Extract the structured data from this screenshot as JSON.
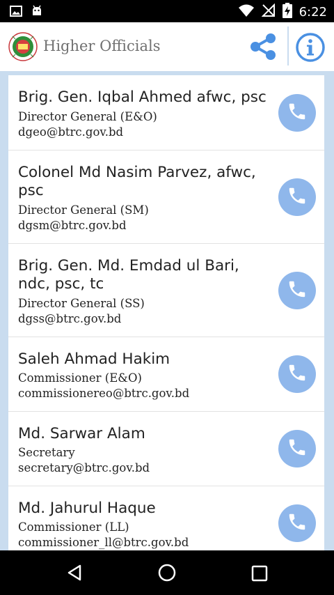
{
  "status_bar": {
    "time": "6:22",
    "left_icons": [
      "image-icon",
      "android-icon"
    ],
    "right_icons": [
      "wifi-icon",
      "no-signal-icon",
      "battery-charging-icon"
    ]
  },
  "app_bar": {
    "title": "Higher Officials",
    "logo": "btrc-logo",
    "actions": [
      "share-icon",
      "info-icon"
    ],
    "accent_color": "#4a90e2"
  },
  "officials": [
    {
      "name": "Brig. Gen. Iqbal Ahmed afwc, psc",
      "role": "Director General (E&O)",
      "email": "dgeo@btrc.gov.bd"
    },
    {
      "name": "Colonel Md Nasim Parvez, afwc, psc",
      "role": "Director General (SM)",
      "email": "dgsm@btrc.gov.bd"
    },
    {
      "name": "Brig. Gen. Md. Emdad ul Bari, ndc, psc, tc",
      "role": "Director General (SS)",
      "email": "dgss@btrc.gov.bd"
    },
    {
      "name": "Saleh Ahmad Hakim",
      "role": "Commissioner (E&O)",
      "email": "commissionereo@btrc.gov.bd"
    },
    {
      "name": "Md. Sarwar Alam",
      "role": "Secretary",
      "email": "secretary@btrc.gov.bd"
    },
    {
      "name": "Md. Jahurul Haque",
      "role": "Commissioner (LL)",
      "email": "commissioner_ll@btrc.gov.bd"
    }
  ],
  "call_button_color": "#8fb7eb",
  "nav_bar": [
    "back-icon",
    "home-icon",
    "recents-icon"
  ]
}
